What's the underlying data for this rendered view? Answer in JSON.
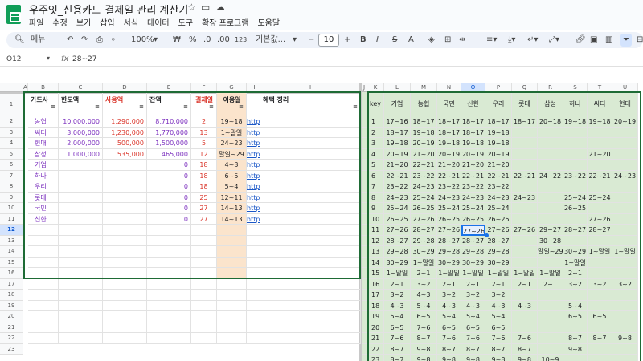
{
  "app": {
    "title": "우주잇_신용카드 결제일 관리 계산기",
    "menu": [
      "파일",
      "수정",
      "보기",
      "삽입",
      "서식",
      "데이터",
      "도구",
      "확장 프로그램",
      "도움말"
    ]
  },
  "toolbar": {
    "search_label": "메뉴",
    "zoom": "100%",
    "currency": "₩",
    "percent": "%",
    "decimal_dec": ".0",
    "decimal_inc": ".00",
    "format_123": "123",
    "font": "기본값...",
    "font_size": "10",
    "bold": "B",
    "italic": "I",
    "strike": "S",
    "text_color": "A"
  },
  "formula_bar": {
    "name_box": "O12",
    "fx": "fx",
    "formula": "28~27"
  },
  "colors": {
    "purple": "#7b2fbe",
    "red": "#d93025",
    "blue": "#1a57c7",
    "peach": "#fbe4cc",
    "green_fill": "#d9ead3",
    "border_green": "#1e6b35"
  },
  "left": {
    "col_letters": [
      "A",
      "B",
      "C",
      "D",
      "E",
      "F",
      "G",
      "H",
      "I"
    ],
    "headers": [
      "카드사",
      "한도액",
      "사용액",
      "잔액",
      "결제일",
      "이용일",
      "",
      "혜택 정리"
    ],
    "rows": [
      [
        "2",
        "농협",
        "10,000,000",
        "1,290,000",
        "8,710,000",
        "2",
        "19~18",
        "http"
      ],
      [
        "3",
        "씨티",
        "3,000,000",
        "1,230,000",
        "1,770,000",
        "13",
        "1~말일",
        "http"
      ],
      [
        "4",
        "현대",
        "2,000,000",
        "500,000",
        "1,500,000",
        "5",
        "24~23",
        "http"
      ],
      [
        "5",
        "삼성",
        "1,000,000",
        "535,000",
        "465,000",
        "12",
        "말일~29",
        "http"
      ],
      [
        "6",
        "기업",
        "",
        "",
        "0",
        "18",
        "4~3",
        "http"
      ],
      [
        "7",
        "하나",
        "",
        "",
        "0",
        "18",
        "6~5",
        "http"
      ],
      [
        "8",
        "우리",
        "",
        "",
        "0",
        "18",
        "5~4",
        "http"
      ],
      [
        "9",
        "롯데",
        "",
        "",
        "0",
        "25",
        "12~11",
        "http"
      ],
      [
        "10",
        "국민",
        "",
        "",
        "0",
        "27",
        "14~13",
        "http"
      ],
      [
        "11",
        "신한",
        "",
        "",
        "0",
        "27",
        "14~13",
        "http"
      ],
      [
        "12",
        "",
        "",
        "",
        "",
        "",
        "",
        ""
      ],
      [
        "13",
        "",
        "",
        "",
        "",
        "",
        "",
        ""
      ],
      [
        "14",
        "",
        "",
        "",
        "",
        "",
        "",
        ""
      ],
      [
        "15",
        "",
        "",
        "",
        "",
        "",
        "",
        ""
      ],
      [
        "16",
        "",
        "",
        "",
        "",
        "",
        "",
        ""
      ],
      [
        "17",
        "",
        "",
        "",
        "",
        "",
        "",
        ""
      ],
      [
        "18",
        "",
        "",
        "",
        "",
        "",
        "",
        ""
      ],
      [
        "19",
        "",
        "",
        "",
        "",
        "",
        "",
        ""
      ],
      [
        "20",
        "",
        "",
        "",
        "",
        "",
        "",
        ""
      ],
      [
        "21",
        "",
        "",
        "",
        "",
        "",
        "",
        ""
      ],
      [
        "22",
        "",
        "",
        "",
        "",
        "",
        "",
        ""
      ]
    ]
  },
  "right": {
    "col_letters": [
      "J",
      "K",
      "L",
      "M",
      "N",
      "O",
      "P",
      "Q",
      "R",
      "S",
      "T",
      "U"
    ],
    "headers": [
      "key",
      "기업",
      "농협",
      "국민",
      "신한",
      "우리",
      "롯데",
      "삼성",
      "하나",
      "씨티",
      "현대"
    ],
    "rows": [
      [
        "1",
        "17~16",
        "18~17",
        "18~17",
        "18~17",
        "18~17",
        "18~17",
        "20~18",
        "19~18",
        "19~18",
        "20~19"
      ],
      [
        "2",
        "18~17",
        "19~18",
        "18~17",
        "18~17",
        "19~18",
        "",
        "",
        "",
        "",
        ""
      ],
      [
        "3",
        "19~18",
        "20~19",
        "19~18",
        "19~18",
        "19~18",
        "",
        "",
        "",
        "",
        ""
      ],
      [
        "4",
        "20~19",
        "21~20",
        "20~19",
        "20~19",
        "20~19",
        "",
        "",
        "",
        "21~20",
        ""
      ],
      [
        "5",
        "21~20",
        "22~21",
        "21~20",
        "21~20",
        "21~20",
        "",
        "",
        "",
        "",
        ""
      ],
      [
        "6",
        "22~21",
        "23~22",
        "22~21",
        "22~21",
        "22~21",
        "22~21",
        "24~22",
        "23~22",
        "22~21",
        "24~23"
      ],
      [
        "7",
        "23~22",
        "24~23",
        "23~22",
        "23~22",
        "23~22",
        "",
        "",
        "",
        "",
        ""
      ],
      [
        "8",
        "24~23",
        "25~24",
        "24~23",
        "24~23",
        "24~23",
        "24~23",
        "",
        "25~24",
        "25~24",
        ""
      ],
      [
        "9",
        "25~24",
        "26~25",
        "25~24",
        "25~24",
        "25~24",
        "",
        "",
        "26~25",
        "",
        ""
      ],
      [
        "10",
        "26~25",
        "27~26",
        "26~25",
        "26~25",
        "26~25",
        "",
        "",
        "",
        "27~26",
        ""
      ],
      [
        "11",
        "27~26",
        "28~27",
        "27~26",
        "27~26",
        "27~26",
        "27~26",
        "29~27",
        "28~27",
        "28~27",
        ""
      ],
      [
        "12",
        "28~27",
        "29~28",
        "28~27",
        "28~27",
        "28~27",
        "",
        "30~28",
        "",
        "",
        ""
      ],
      [
        "13",
        "29~28",
        "30~29",
        "29~28",
        "29~28",
        "29~28",
        "",
        "말일~29",
        "30~29",
        "1~말일",
        "1~말일"
      ],
      [
        "14",
        "30~29",
        "1~말일",
        "30~29",
        "30~29",
        "30~29",
        "",
        "",
        "1~말일",
        "",
        ""
      ],
      [
        "15",
        "1~말일",
        "2~1",
        "1~말일",
        "1~말일",
        "1~말일",
        "1~말일",
        "1~말일",
        "2~1",
        "",
        ""
      ],
      [
        "16",
        "2~1",
        "3~2",
        "2~1",
        "2~1",
        "2~1",
        "2~1",
        "2~1",
        "3~2",
        "3~2",
        "3~2"
      ],
      [
        "17",
        "3~2",
        "4~3",
        "3~2",
        "3~2",
        "3~2",
        "",
        "",
        "",
        "",
        ""
      ],
      [
        "18",
        "4~3",
        "5~4",
        "4~3",
        "4~3",
        "4~3",
        "4~3",
        "",
        "5~4",
        "",
        ""
      ],
      [
        "19",
        "5~4",
        "6~5",
        "5~4",
        "5~4",
        "5~4",
        "",
        "",
        "6~5",
        "6~5",
        ""
      ],
      [
        "20",
        "6~5",
        "7~6",
        "6~5",
        "6~5",
        "6~5",
        "",
        "",
        "",
        "",
        ""
      ],
      [
        "21",
        "7~6",
        "8~7",
        "7~6",
        "7~6",
        "7~6",
        "7~6",
        "",
        "8~7",
        "8~7",
        "9~8"
      ],
      [
        "22",
        "8~7",
        "9~8",
        "8~7",
        "8~7",
        "8~7",
        "8~7",
        "",
        "9~8",
        "",
        ""
      ],
      [
        "23",
        "8~7",
        "9~8",
        "9~8",
        "9~8",
        "9~8",
        "9~8",
        "10~9",
        "",
        "",
        ""
      ]
    ]
  },
  "row_numbers": [
    "1",
    "2",
    "3",
    "4",
    "5",
    "6",
    "7",
    "8",
    "9",
    "10",
    "11",
    "12",
    "13",
    "14",
    "15",
    "16",
    "17",
    "18",
    "19",
    "20",
    "21",
    "22",
    "23"
  ]
}
